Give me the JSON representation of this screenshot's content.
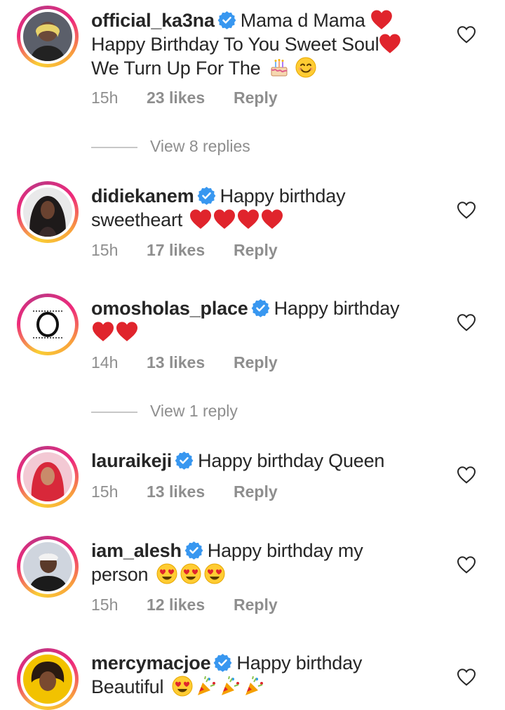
{
  "comments": [
    {
      "username": "official_ka3na",
      "text": "Mama d Mama",
      "text2": "Happy Birthday To You Sweet Soul",
      "text3": "We Turn Up For The",
      "time": "15h",
      "likes": "23 likes",
      "reply": "Reply",
      "replies_link": "View 8 replies"
    },
    {
      "username": "didiekanem",
      "text": "Happy birthday",
      "text2": "sweetheart",
      "time": "15h",
      "likes": "17 likes",
      "reply": "Reply"
    },
    {
      "username": "omosholas_place",
      "text": "Happy birthday",
      "time": "14h",
      "likes": "13 likes",
      "reply": "Reply",
      "replies_link": "View 1 reply"
    },
    {
      "username": "lauraikeji",
      "text": "Happy birthday Queen",
      "time": "15h",
      "likes": "13 likes",
      "reply": "Reply"
    },
    {
      "username": "iam_alesh",
      "text": "Happy birthday my",
      "text2": "person",
      "time": "15h",
      "likes": "12 likes",
      "reply": "Reply"
    },
    {
      "username": "mercymacjoe",
      "text": "Happy birthday",
      "text2": "Beautiful"
    }
  ],
  "icons": {
    "verified": "verified-badge-icon",
    "like": "heart-outline-icon"
  },
  "colors": {
    "verified_blue": "#3897f0",
    "meta_gray": "#8e8e8e",
    "heart_red": "#e0242c"
  }
}
